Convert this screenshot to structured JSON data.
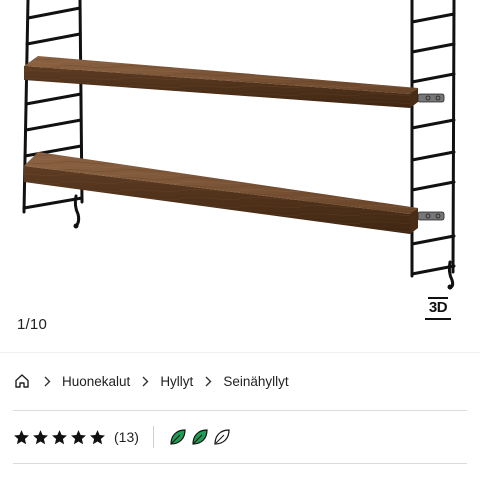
{
  "gallery": {
    "counter_current": "1",
    "counter_total": "10",
    "view_3d_label": "3D"
  },
  "breadcrumb": {
    "home_icon": "home-icon",
    "items": [
      {
        "label": "Huonekalut"
      },
      {
        "label": "Hyllyt"
      },
      {
        "label": "Seinähyllyt"
      }
    ]
  },
  "rating": {
    "stars": 5,
    "review_count": "(13)",
    "eco_score_filled": 2,
    "eco_score_total": 3
  },
  "colors": {
    "star": "#111111",
    "eco_green": "#1f9d55",
    "wood": "#7a5234",
    "frame": "#111111"
  }
}
